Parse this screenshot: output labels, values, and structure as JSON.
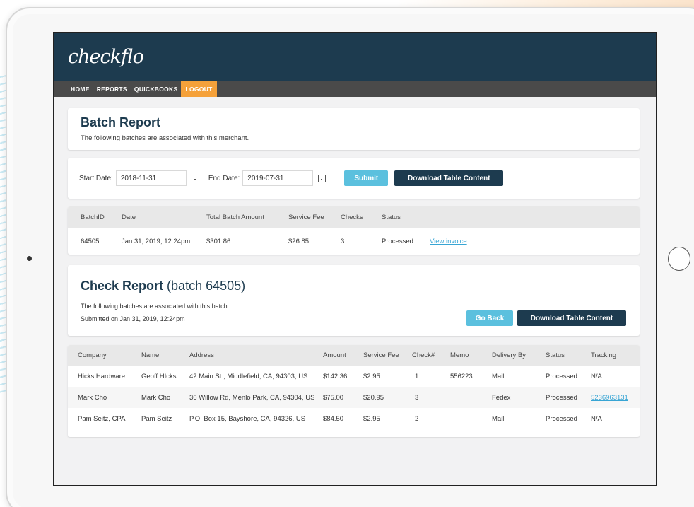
{
  "app": {
    "logo": "checkflo"
  },
  "nav": [
    {
      "label": "HOME"
    },
    {
      "label": "REPORTS"
    },
    {
      "label": "QUICKBOOKS"
    },
    {
      "label": "LOGOUT",
      "active": true
    }
  ],
  "batch_report": {
    "title": "Batch Report",
    "description": "The following batches are associated with this merchant."
  },
  "filters": {
    "start_label": "Start Date:",
    "start_value": "2018-11-31",
    "end_label": "End Date:",
    "end_value": "2019-07-31",
    "submit_label": "Submit",
    "download_label": "Download Table Content"
  },
  "batch_table": {
    "columns": [
      "BatchID",
      "Date",
      "Total Batch Amount",
      "Service Fee",
      "Checks",
      "Status"
    ],
    "rows": [
      {
        "batch_id": "64505",
        "date": "Jan 31, 2019, 12:24pm",
        "total": "$301.86",
        "fee": "$26.85",
        "checks": "3",
        "status": "Processed",
        "link": "View invoice"
      }
    ]
  },
  "check_report": {
    "title": "Check Report",
    "subtitle": "(batch 64505)",
    "description": "The following batches are associated with this batch.",
    "submitted": "Submitted on Jan 31, 2019, 12:24pm",
    "back_label": "Go Back",
    "download_label": "Download Table Content"
  },
  "check_table": {
    "columns": [
      "Company",
      "Name",
      "Address",
      "Amount",
      "Service Fee",
      "Check#",
      "Memo",
      "Delivery By",
      "Status",
      "Tracking"
    ],
    "rows": [
      {
        "company": "Hicks Hardware",
        "name": "Geoff HIcks",
        "address": "42 Main St., Middlefield, CA, 94303, US",
        "amount": "$142.36",
        "fee": "$2.95",
        "check": "1",
        "memo": "556223",
        "delivery": "Mail",
        "status": "Processed",
        "tracking": "N/A"
      },
      {
        "company": "Mark Cho",
        "name": "Mark Cho",
        "address": "36 Willow Rd, Menlo Park, CA, 94304, US",
        "amount": "$75.00",
        "fee": "$20.95",
        "check": "3",
        "memo": "",
        "delivery": "Fedex",
        "status": "Processed",
        "tracking": "5236963131"
      },
      {
        "company": "Pam Seitz, CPA",
        "name": "Pam Seitz",
        "address": "P.O. Box 15, Bayshore, CA, 94326, US",
        "amount": "$84.50",
        "fee": "$2.95",
        "check": "2",
        "memo": "",
        "delivery": "Mail",
        "status": "Processed",
        "tracking": "N/A"
      }
    ]
  },
  "colors": {
    "primary": "#1d3b4f",
    "accent": "#f5a13a",
    "button_light": "#5bc0de",
    "link": "#38a5d4"
  }
}
